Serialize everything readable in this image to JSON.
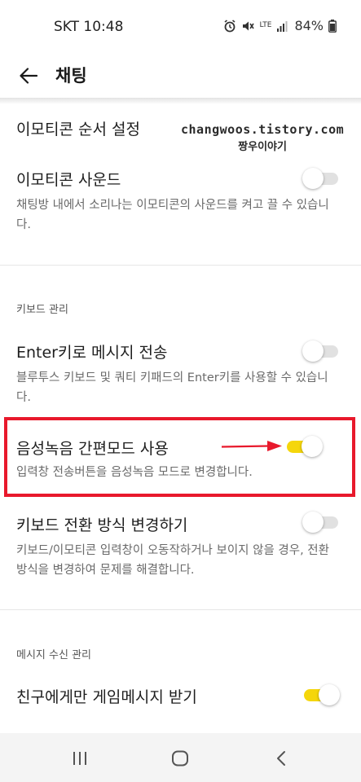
{
  "status_bar": {
    "carrier_time": "SKT 10:48",
    "battery": "84%",
    "network": "LTE"
  },
  "header": {
    "title": "채팅",
    "back_icon": "arrow-left-icon"
  },
  "watermark": {
    "line1": "changwoos.tistory.com",
    "line2": "짱우이야기"
  },
  "settings": {
    "emoticon_order": {
      "title": "이모티콘 순서 설정"
    },
    "emoticon_sound": {
      "title": "이모티콘 사운드",
      "desc": "채팅방 내에서 소리나는 이모티콘의 사운드를 켜고 끌 수 있습니다.",
      "enabled": false
    },
    "keyboard_section": {
      "label": "키보드 관리"
    },
    "enter_send": {
      "title": "Enter키로 메시지 전송",
      "desc": "블루투스 키보드 및 쿼티 키패드의 Enter키를 사용할 수 있습니다.",
      "enabled": false
    },
    "voice_easy": {
      "title": "음성녹음 간편모드 사용",
      "desc": "입력창 전송버튼을 음성녹음 모드로 변경합니다.",
      "enabled": true
    },
    "keyboard_switch": {
      "title": "키보드 전환 방식 변경하기",
      "desc": "키보드/이모티콘 입력창이 오동작하거나 보이지 않을 경우, 전환 방식을 변경하여 문제를 해결합니다.",
      "enabled": false
    },
    "message_section": {
      "label": "메시지 수신 관리"
    },
    "friend_game": {
      "title": "친구에게만 게임메시지 받기",
      "enabled": true
    }
  },
  "colors": {
    "toggle_on": "#f5d60b",
    "toggle_off": "#e1e1e1",
    "highlight": "#e8192c"
  },
  "nav": {
    "recents_icon": "recents-icon",
    "home_icon": "home-icon",
    "back_icon": "back-chevron-icon"
  }
}
